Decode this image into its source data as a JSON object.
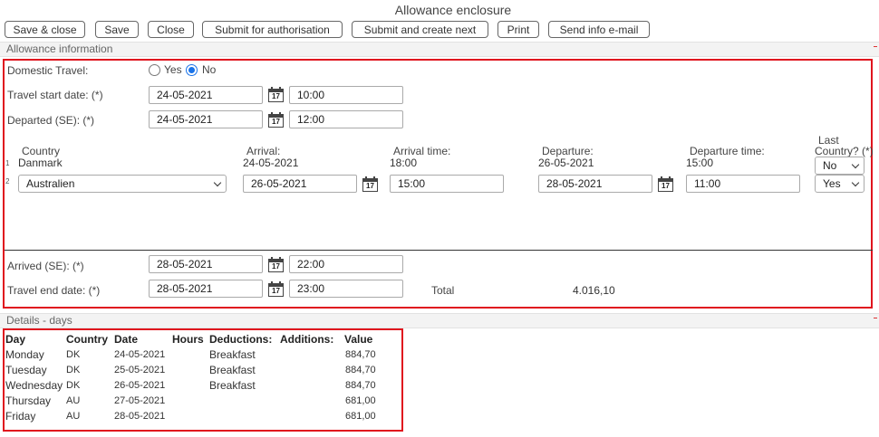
{
  "window": {
    "title": "Allowance enclosure"
  },
  "toolbar": {
    "save_close": "Save & close",
    "save": "Save",
    "close": "Close",
    "submit_auth": "Submit for authorisation",
    "submit_next": "Submit and create next",
    "print": "Print",
    "send_info": "Send info e-mail"
  },
  "allowance": {
    "section_title": "Allowance information",
    "domestic_label": "Domestic Travel:",
    "domestic_yes": "Yes",
    "domestic_no": "No",
    "start_label": "Travel start date: (*)",
    "start_date": "24-05-2021",
    "start_time": "10:00",
    "departed_label": "Departed (SE): (*)",
    "departed_date": "24-05-2021",
    "departed_time": "12:00",
    "cols": {
      "country": "Country",
      "arrival": "Arrival:",
      "arrival_time": "Arrival time:",
      "departure": "Departure:",
      "departure_time": "Departure time:",
      "last_country_1": "Last",
      "last_country_2": "Country? (*)"
    },
    "row1": {
      "num": "1",
      "country": "Danmark",
      "arrival": "24-05-2021",
      "arrival_time": "18:00",
      "departure": "26-05-2021",
      "departure_time": "15:00",
      "last": "No"
    },
    "row2": {
      "num": "2",
      "country": "Australien",
      "arrival": "26-05-2021",
      "arrival_time": "15:00",
      "departure": "28-05-2021",
      "departure_time": "11:00",
      "last": "Yes"
    },
    "arrived_label": "Arrived (SE): (*)",
    "arrived_date": "28-05-2021",
    "arrived_time": "22:00",
    "end_label": "Travel end date: (*)",
    "end_date": "28-05-2021",
    "end_time": "23:00",
    "total_label": "Total",
    "total_value": "4.016,10",
    "calendar_num": "17"
  },
  "details": {
    "section_title": "Details - days",
    "headers": [
      "Day",
      "Country",
      "Date",
      "Hours",
      "Deductions:",
      "Additions:",
      "Value"
    ],
    "rows": [
      {
        "day": "Monday",
        "country": "DK",
        "date": "24-05-2021",
        "deductions": "Breakfast",
        "value": "884,70"
      },
      {
        "day": "Tuesday",
        "country": "DK",
        "date": "25-05-2021",
        "deductions": "Breakfast",
        "value": "884,70"
      },
      {
        "day": "Wednesday",
        "country": "DK",
        "date": "26-05-2021",
        "deductions": "Breakfast",
        "value": "884,70"
      },
      {
        "day": "Thursday",
        "country": "AU",
        "date": "27-05-2021",
        "deductions": "",
        "value": "681,00"
      },
      {
        "day": "Friday",
        "country": "AU",
        "date": "28-05-2021",
        "deductions": "",
        "value": "681,00"
      }
    ]
  }
}
